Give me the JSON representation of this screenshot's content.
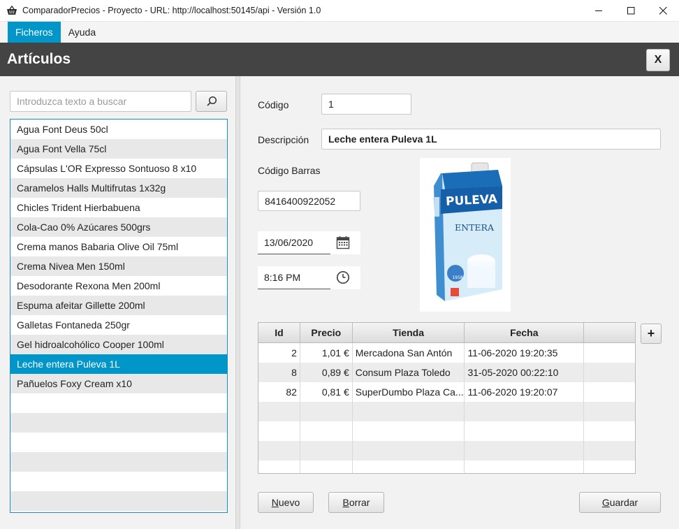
{
  "window": {
    "title": "ComparadorPrecios - Proyecto - URL: http://localhost:50145/api - Versión 1.0",
    "minimize": "—",
    "maximize": "☐",
    "close": "✕"
  },
  "menu": {
    "items": [
      {
        "label": "Ficheros",
        "active": true
      },
      {
        "label": "Ayuda",
        "active": false
      }
    ]
  },
  "header": {
    "title": "Artículos",
    "close_label": "X"
  },
  "search": {
    "placeholder": "Introduzca texto a buscar",
    "value": ""
  },
  "articles": [
    "Agua Font Deus 50cl",
    "Agua Font Vella 75cl",
    "Cápsulas L'OR Expresso Sontuoso 8 x10",
    "Caramelos Halls Multifrutas 1x32g",
    "Chicles Trident Hierbabuena",
    "Cola-Cao 0% Azúcares 500grs",
    "Crema manos Babaria Olive Oil 75ml",
    "Crema Nivea Men 150ml",
    "Desodorante Rexona Men 200ml",
    "Espuma afeitar Gillette 200ml",
    "Galletas Fontaneda 250gr",
    "Gel hidroalcohólico Cooper 100ml",
    "Leche entera Puleva 1L",
    "Pañuelos Foxy Cream x10"
  ],
  "selected_index": 12,
  "form": {
    "codigo_label": "Código",
    "codigo_value": "1",
    "descripcion_label": "Descripción",
    "descripcion_value": "Leche entera Puleva 1L",
    "barras_label": "Código Barras",
    "barras_value": "8416400922052",
    "date_value": "13/06/2020",
    "time_value": "8:16 PM"
  },
  "product_image": {
    "brand": "PULEVA",
    "variant": "ENTERA",
    "year": "1958"
  },
  "table": {
    "headers": [
      "Id",
      "Precio",
      "Tienda",
      "Fecha",
      ""
    ],
    "rows": [
      [
        "2",
        "1,01 €",
        "Mercadona San Antón",
        "11-06-2020 19:20:35",
        ""
      ],
      [
        "8",
        "0,89 €",
        "Consum Plaza Toledo",
        "31-05-2020 00:22:10",
        ""
      ],
      [
        "82",
        "0,81 €",
        "SuperDumbo Plaza Ca...",
        "11-06-2020 19:20:07",
        ""
      ]
    ]
  },
  "buttons": {
    "add": "+",
    "nuevo_acc": "N",
    "nuevo_rest": "uevo",
    "borrar_acc": "B",
    "borrar_rest": "orrar",
    "guardar_acc": "G",
    "guardar_rest": "uardar"
  },
  "colors": {
    "accent": "#0096c9",
    "header_bg": "#444444"
  }
}
